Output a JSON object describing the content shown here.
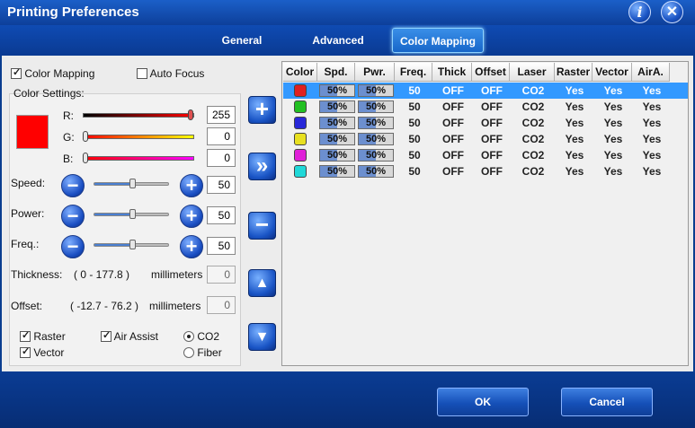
{
  "window": {
    "title": "Printing Preferences",
    "info_glyph": "i",
    "close_glyph": "✕"
  },
  "tabs": {
    "general": "General",
    "advanced": "Advanced",
    "color_mapping": "Color Mapping",
    "active": "Color Mapping"
  },
  "left": {
    "color_mapping_label": "Color Mapping",
    "color_mapping_checked": true,
    "auto_focus_label": "Auto Focus",
    "auto_focus_checked": false,
    "group_title": "Color Settings:",
    "swatch_color": "#ff0000",
    "r_label": "R:",
    "r_value": "255",
    "g_label": "G:",
    "g_value": "0",
    "b_label": "B:",
    "b_value": "0",
    "speed_label": "Speed:",
    "speed_value": "50",
    "power_label": "Power:",
    "power_value": "50",
    "freq_label": "Freq.:",
    "freq_value": "50",
    "thickness_label": "Thickness:",
    "thickness_range": "( 0   -   177.8 )",
    "thickness_unit": "millimeters",
    "thickness_value": "0",
    "offset_label": "Offset:",
    "offset_range": "( -12.7   -   76.2 )",
    "offset_unit": "millimeters",
    "offset_value": "0",
    "raster_label": "Raster",
    "vector_label": "Vector",
    "air_assist_label": "Air Assist",
    "co2_label": "CO2",
    "fiber_label": "Fiber",
    "minus_glyph": "−",
    "plus_glyph": "+"
  },
  "side_buttons": {
    "add": "+",
    "apply": "»",
    "remove": "−",
    "up": "▲",
    "down": "▼"
  },
  "table": {
    "headers": [
      "Color",
      "Spd.",
      "Pwr.",
      "Freq.",
      "Thick",
      "Offset",
      "Laser",
      "Raster",
      "Vector",
      "AirA."
    ],
    "rows": [
      {
        "color": "#e02020",
        "spd": "50%",
        "pwr": "50%",
        "freq": "50",
        "thick": "OFF",
        "offset": "OFF",
        "laser": "CO2",
        "raster": "Yes",
        "vector": "Yes",
        "aira": "Yes"
      },
      {
        "color": "#22c022",
        "spd": "50%",
        "pwr": "50%",
        "freq": "50",
        "thick": "OFF",
        "offset": "OFF",
        "laser": "CO2",
        "raster": "Yes",
        "vector": "Yes",
        "aira": "Yes"
      },
      {
        "color": "#2828d8",
        "spd": "50%",
        "pwr": "50%",
        "freq": "50",
        "thick": "OFF",
        "offset": "OFF",
        "laser": "CO2",
        "raster": "Yes",
        "vector": "Yes",
        "aira": "Yes"
      },
      {
        "color": "#e8e020",
        "spd": "50%",
        "pwr": "50%",
        "freq": "50",
        "thick": "OFF",
        "offset": "OFF",
        "laser": "CO2",
        "raster": "Yes",
        "vector": "Yes",
        "aira": "Yes"
      },
      {
        "color": "#e020d8",
        "spd": "50%",
        "pwr": "50%",
        "freq": "50",
        "thick": "OFF",
        "offset": "OFF",
        "laser": "CO2",
        "raster": "Yes",
        "vector": "Yes",
        "aira": "Yes"
      },
      {
        "color": "#20d8d8",
        "spd": "50%",
        "pwr": "50%",
        "freq": "50",
        "thick": "OFF",
        "offset": "OFF",
        "laser": "CO2",
        "raster": "Yes",
        "vector": "Yes",
        "aira": "Yes"
      }
    ]
  },
  "footer": {
    "ok": "OK",
    "cancel": "Cancel"
  }
}
